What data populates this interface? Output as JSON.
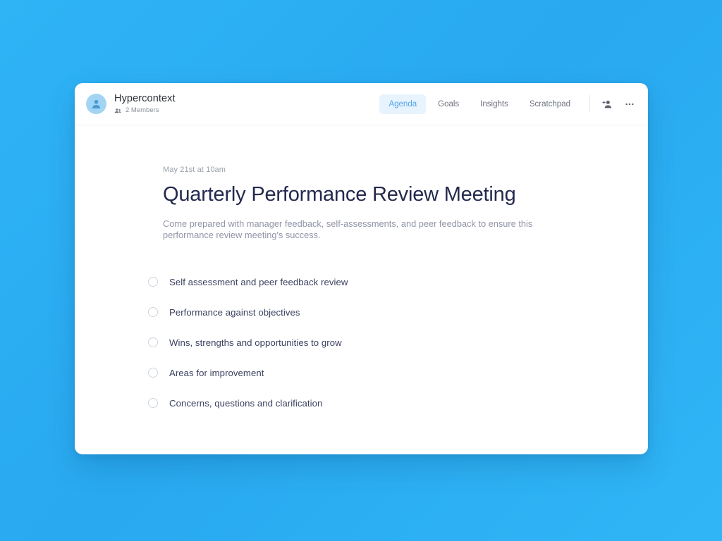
{
  "header": {
    "team_name": "Hypercontext",
    "members_label": "2 Members",
    "avatar_icon": "person-avatar-icon",
    "members_icon": "group-people-icon",
    "tabs": [
      {
        "label": "Agenda",
        "active": true
      },
      {
        "label": "Goals",
        "active": false
      },
      {
        "label": "Insights",
        "active": false
      },
      {
        "label": "Scratchpad",
        "active": false
      }
    ],
    "actions": [
      {
        "icon": "add-person-icon",
        "name": "add-member-button"
      },
      {
        "icon": "more-options-icon",
        "name": "more-options-button"
      }
    ],
    "accent_color": "#53a5e8",
    "active_tab_bg": "#e7f3fd"
  },
  "meeting": {
    "date": "May 21st at 10am",
    "title": "Quarterly Performance Review Meeting",
    "description": "Come prepared with manager feedback, self-assessments, and peer feedback to ensure this performance review meeting's success."
  },
  "agenda": {
    "items": [
      {
        "label": "Self assessment and peer feedback review",
        "checked": false
      },
      {
        "label": "Performance against objectives",
        "checked": false
      },
      {
        "label": "Wins, strengths and opportunities to grow",
        "checked": false
      },
      {
        "label": "Areas for improvement",
        "checked": false
      },
      {
        "label": "Concerns, questions and clarification",
        "checked": false
      }
    ]
  },
  "background": {
    "color_from": "#2fb4f6",
    "color_to": "#30b6f7"
  }
}
